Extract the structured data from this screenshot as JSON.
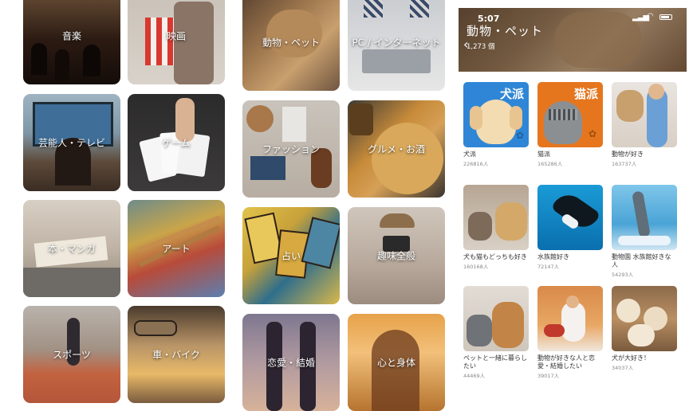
{
  "categories": {
    "col1": [
      "音楽",
      "芸能人・テレビ",
      "本・マンガ",
      "スポーツ"
    ],
    "col2": [
      "映画",
      "ゲーム",
      "アート",
      "車・バイク"
    ],
    "col3": [
      "動物・ペット",
      "ファッション",
      "占い",
      "恋愛・結婚"
    ],
    "col4": [
      "PC / インターネット",
      "グルメ・お酒",
      "趣味全般",
      "心と身体"
    ]
  },
  "status_bar": {
    "time": "5:07"
  },
  "header": {
    "title": "動物・ペット",
    "count": "1,273 個",
    "back_icon": "chevron-left-icon"
  },
  "communities": [
    {
      "name": "犬派",
      "members": "226816人",
      "badge": "犬派",
      "badge_color": "#2f86d6"
    },
    {
      "name": "猫派",
      "members": "165286人",
      "badge": "猫派",
      "badge_color": "#e5761e"
    },
    {
      "name": "動物が好き",
      "members": "163737人"
    },
    {
      "name": "犬も猫もどっちも好き",
      "members": "160168人"
    },
    {
      "name": "水族館好き",
      "members": "72147人"
    },
    {
      "name": "動物園 水族館好きな人",
      "members": "54293人"
    },
    {
      "name": "ペットと一緒に暮らしたい",
      "members": "44469人"
    },
    {
      "name": "動物が好きな人と恋愛・結婚したい",
      "members": "39017人"
    },
    {
      "name": "犬が大好き！",
      "members": "34037人"
    }
  ]
}
